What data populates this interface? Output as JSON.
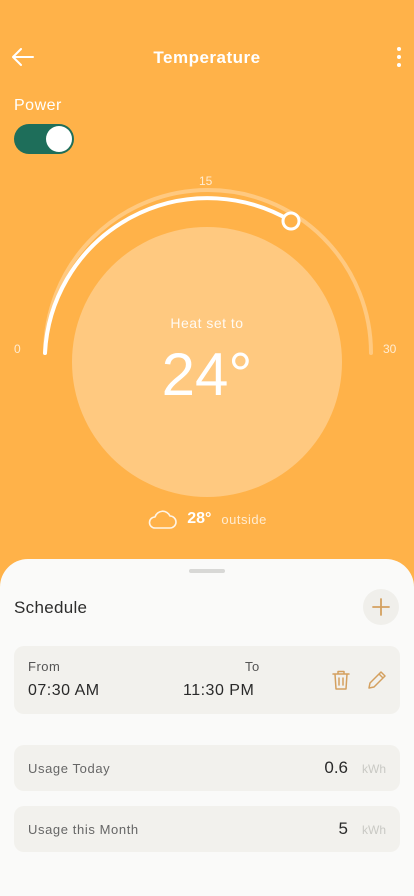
{
  "header": {
    "title": "Temperature",
    "back_icon": "arrow-left-icon",
    "menu_icon": "more-vertical-icon"
  },
  "power": {
    "label": "Power",
    "on": true,
    "toggle_color": "#1e6e5a"
  },
  "thermostat": {
    "min_label": "0",
    "mid_label": "15",
    "max_label": "30",
    "setpoint_value": 24,
    "set_label": "Heat set to",
    "setpoint_display": "24°",
    "outside_temp": "28°",
    "outside_label": "outside",
    "weather_icon": "cloud-icon",
    "accent_color": "#ffb249"
  },
  "schedule": {
    "title": "Schedule",
    "add_icon": "plus-icon",
    "item": {
      "from_label": "From",
      "from_value": "07:30 AM",
      "to_label": "To",
      "to_value": "11:30 PM",
      "delete_icon": "trash-icon",
      "edit_icon": "pencil-icon"
    }
  },
  "usage": [
    {
      "label": "Usage Today",
      "value": "0.6",
      "unit": "kWh"
    },
    {
      "label": "Usage this Month",
      "value": "5",
      "unit": "kWh"
    }
  ]
}
